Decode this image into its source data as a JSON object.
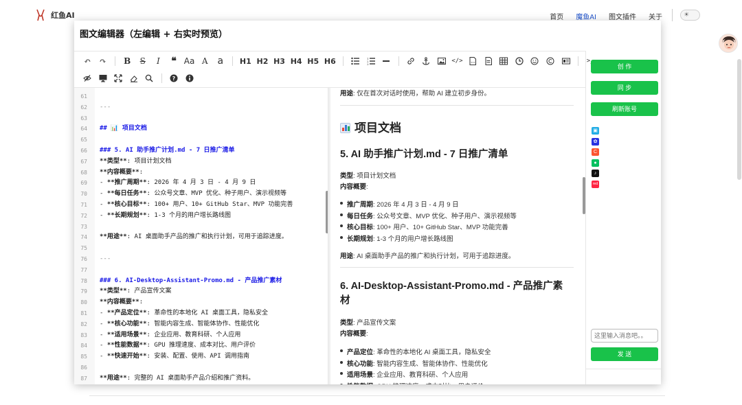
{
  "brand": {
    "name": "红鱼AI"
  },
  "nav": {
    "items": [
      "首页",
      "魔鱼AI",
      "图文插件",
      "关于"
    ],
    "active_index": 1
  },
  "theme_toggle": {
    "icon": "sun-icon"
  },
  "window": {
    "title": "图文编辑器（左编辑 + 右实时预览）"
  },
  "toolbar": {
    "row1": [
      "undo",
      "redo",
      "bold",
      "strikethrough",
      "italic",
      "quote",
      "uppercase",
      "font-size",
      "lowercase",
      "H1",
      "H2",
      "H3",
      "H4",
      "H5",
      "H6",
      "unordered-list",
      "ordered-list",
      "hr",
      "link",
      "anchor",
      "image",
      "code",
      "code-block",
      "preformatted",
      "table",
      "datetime",
      "emoji",
      "html-entities",
      "pagebreak",
      "terminal"
    ],
    "labels": {
      "aa": "Aa",
      "a_upper": "A",
      "a_lower": "a",
      "h1": "H1",
      "h2": "H2",
      "h3": "H3",
      "h4": "H4",
      "h5": "H5",
      "h6": "H6"
    }
  },
  "editor": {
    "lines": [
      {
        "n": "61",
        "t": ""
      },
      {
        "n": "62",
        "t": "---"
      },
      {
        "n": "63",
        "t": ""
      },
      {
        "n": "64",
        "t": "## 📊 项目文档"
      },
      {
        "n": "65",
        "t": ""
      },
      {
        "n": "66",
        "t": "### 5. AI 助手推广计划.md - 7 日推广清单"
      },
      {
        "n": "67",
        "t": "**类型**: 项目计划文档"
      },
      {
        "n": "68",
        "t": "**内容概要**:"
      },
      {
        "n": "69",
        "t": "- **推广周期**: 2026 年 4 月 3 日 - 4 月 9 日"
      },
      {
        "n": "70",
        "t": "- **每日任务**: 公众号文章、MVP 优化、种子用户、演示视频等"
      },
      {
        "n": "71",
        "t": "- **核心目标**: 100+ 用户、10+ GitHub Star、MVP 功能完善"
      },
      {
        "n": "72",
        "t": "- **长期规划**: 1-3 个月的用户增长路线图"
      },
      {
        "n": "73",
        "t": ""
      },
      {
        "n": "74",
        "t": "**用途**: AI 桌面助手产品的推广和执行计划，可用于追踪进度。"
      },
      {
        "n": "75",
        "t": ""
      },
      {
        "n": "76",
        "t": "---"
      },
      {
        "n": "77",
        "t": ""
      },
      {
        "n": "78",
        "t": "### 6. AI-Desktop-Assistant-Promo.md - 产品推广素材"
      },
      {
        "n": "79",
        "t": "**类型**: 产品宣传文案"
      },
      {
        "n": "80",
        "t": "**内容概要**:"
      },
      {
        "n": "81",
        "t": "- **产品定位**: 革命性的本地化 AI 桌面工具，隐私安全"
      },
      {
        "n": "82",
        "t": "- **核心功能**: 智能内容生成、智能体协作、性能优化"
      },
      {
        "n": "83",
        "t": "- **适用场景**: 企业应用、教育科研、个人应用"
      },
      {
        "n": "84",
        "t": "- **性能数据**: GPU 推理速度、成本对比、用户评价"
      },
      {
        "n": "85",
        "t": "- **快速开始**: 安装、配置、使用、API 调用指南"
      },
      {
        "n": "86",
        "t": ""
      },
      {
        "n": "87",
        "t": "**用途**: 完整的 AI 桌面助手产品介绍和推广资料。"
      }
    ]
  },
  "preview": {
    "top_usage_label": "用途",
    "top_usage_text": ": 仅在首次对话时使用，帮助 AI 建立初步身份。",
    "h2": "项目文档",
    "s5": {
      "title": "5. AI 助手推广计划.md - 7 日推广清单",
      "type_label": "类型",
      "type_text": ": 项目计划文档",
      "summary_label": "内容概要",
      "summary_colon": ":",
      "items": [
        {
          "label": "推广周期",
          "text": ": 2026 年 4 月 3 日 - 4 月 9 日"
        },
        {
          "label": "每日任务",
          "text": ": 公众号文章、MVP 优化、种子用户、演示视频等"
        },
        {
          "label": "核心目标",
          "text": ": 100+ 用户、10+ GitHub Star、MVP 功能完善"
        },
        {
          "label": "长期规划",
          "text": ": 1-3 个月的用户增长路线图"
        }
      ],
      "usage_label": "用途",
      "usage_text": ": AI 桌面助手产品的推广和执行计划，可用于追踪进度。"
    },
    "s6": {
      "title": "6. AI-Desktop-Assistant-Promo.md - 产品推广素材",
      "type_label": "类型",
      "type_text": ": 产品宣传文案",
      "summary_label": "内容概要",
      "summary_colon": ":",
      "items": [
        {
          "label": "产品定位",
          "text": ": 革命性的本地化 AI 桌面工具，隐私安全"
        },
        {
          "label": "核心功能",
          "text": ": 智能内容生成、智能体协作、性能优化"
        },
        {
          "label": "适用场景",
          "text": ": 企业应用、教育科研、个人应用"
        },
        {
          "label": "性能数据",
          "text": ": GPU 推理速度、成本对比、用户评价"
        }
      ]
    }
  },
  "sidebar": {
    "create_label": "创 作",
    "sync_label": "同 步",
    "refresh_label": "刷新账号",
    "platforms": [
      {
        "name": "bilibili-icon",
        "color": "#23ade5",
        "glyph": "▣"
      },
      {
        "name": "baidu-icon",
        "color": "#2932e1",
        "glyph": "✿"
      },
      {
        "name": "csdn-icon",
        "color": "#fc5531",
        "glyph": "C"
      },
      {
        "name": "wechat-icon",
        "color": "#07c160",
        "glyph": "●"
      },
      {
        "name": "douyin-icon",
        "color": "#111111",
        "glyph": "♪"
      },
      {
        "name": "xiaohongshu-icon",
        "color": "#ff2442",
        "glyph": "red"
      }
    ],
    "message_placeholder": "这里输入消息吧。。",
    "send_label": "发 送"
  },
  "colors": {
    "accent_green": "#19c24a",
    "heading_blue": "#1a1ae6",
    "nav_active": "#2255cc"
  }
}
